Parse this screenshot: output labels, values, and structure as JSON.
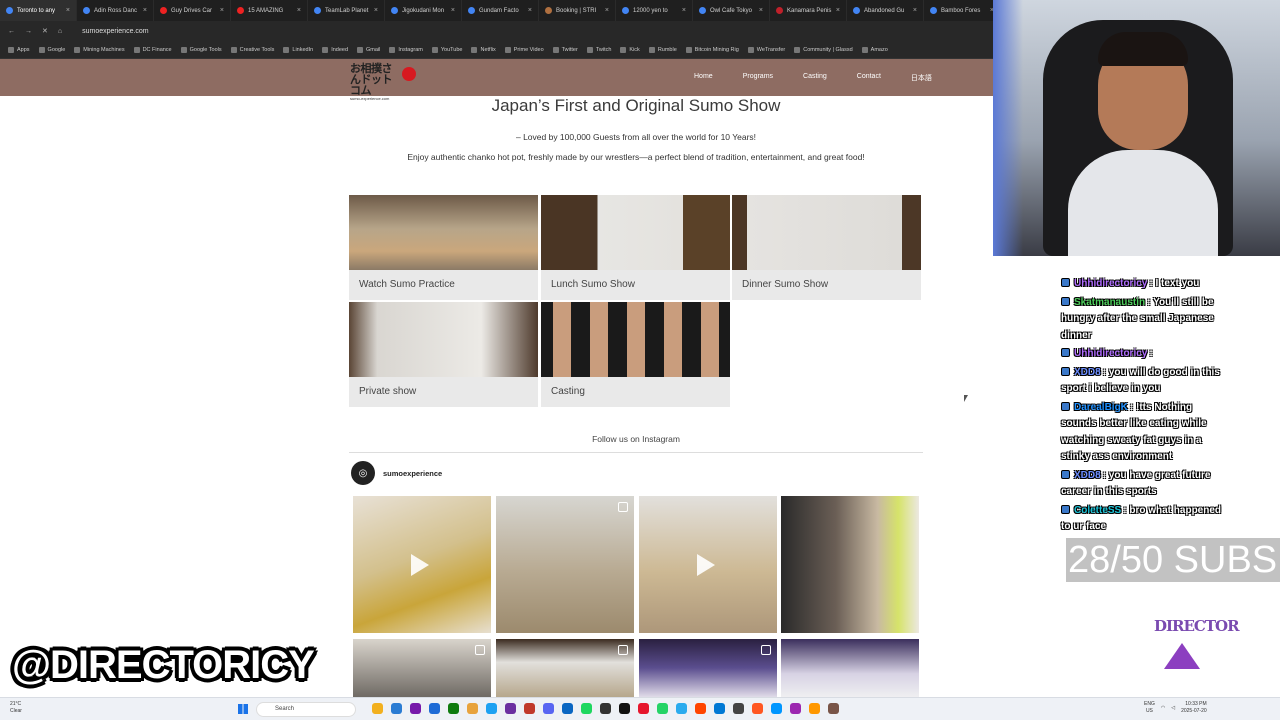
{
  "browser": {
    "tabs": [
      "Toronto to any",
      "Adin Ross Danc",
      "Guy Drives Car",
      "15 AMAZING",
      "TeamLab Planet",
      "Jigokudani Mon",
      "Gundam Facto",
      "Booking | STRI",
      "12000 yen to",
      "Owl Cafe Tokyo",
      "Kanamara Penis",
      "Abandoned Gu",
      "Bamboo Fores"
    ],
    "url": "sumoexperience.com",
    "bookmarks": [
      "Apps",
      "Google",
      "Mining Machines",
      "DC Finance",
      "Google Tools",
      "Creative Tools",
      "LinkedIn",
      "Indeed",
      "Gmail",
      "Instagram",
      "YouTube",
      "Netflix",
      "Prime Video",
      "Twitter",
      "Twitch",
      "Kick",
      "Rumble",
      "Bitcoin Mining Rig",
      "WeTransfer",
      "Community | Glassd",
      "Amazo"
    ]
  },
  "site": {
    "logo_text": "お相撲さんドットコム",
    "logo_sub": "sumo-experience.com",
    "nav": [
      "Home",
      "Programs",
      "Casting",
      "Contact",
      "日本語"
    ],
    "title": "Japan’s First and Original Sumo Show",
    "tagline1": "– Loved by 100,000 Guests from all over the world for 10 Years!",
    "tagline2": "Enjoy authentic chanko hot pot, freshly made by our wrestlers—a perfect blend of tradition, entertainment, and great food!",
    "programs": [
      "Watch Sumo Practice",
      "Lunch Sumo Show",
      "Dinner Sumo Show",
      "Private show",
      "Casting"
    ],
    "follow_text": "Follow us on Instagram",
    "instagram_handle": "sumoexperience"
  },
  "stream": {
    "chat": [
      {
        "user": "Uhhidirectoricy",
        "user_color": "#b06cff",
        "text": ": I text you"
      },
      {
        "user": "Skatmanaustin",
        "user_color": "#4ccd5a",
        "text": ": You'll still be hungry after the small Japanese dinner"
      },
      {
        "user": "Uhhidirectoricy",
        "user_color": "#b06cff",
        "text": ":"
      },
      {
        "user": "XDD8",
        "user_color": "#6a8cff",
        "text": ": you will do good in this sport i believe in you"
      },
      {
        "user": "DarealBigK",
        "user_color": "#1e90ff",
        "text": ": !tts Nothing sounds better like eating while watching sweaty fat guys in a stinky ass environment"
      },
      {
        "user": "XDD8",
        "user_color": "#6a8cff",
        "text": ": you have great future career in this sports"
      },
      {
        "user": "ColetteSS",
        "user_color": "#19c2d6",
        "text": ": bro what happened to ur face"
      }
    ],
    "subs_goal": "28/50 SUBS",
    "handle": "@DIRECTORICY",
    "watermark": "DIRECTOR"
  },
  "taskbar": {
    "weather_temp": "21°C",
    "weather_desc": "Clear",
    "search": "Search",
    "lang": "ENG",
    "region": "US",
    "time": "10:33 PM",
    "date": "2025-07-20"
  }
}
